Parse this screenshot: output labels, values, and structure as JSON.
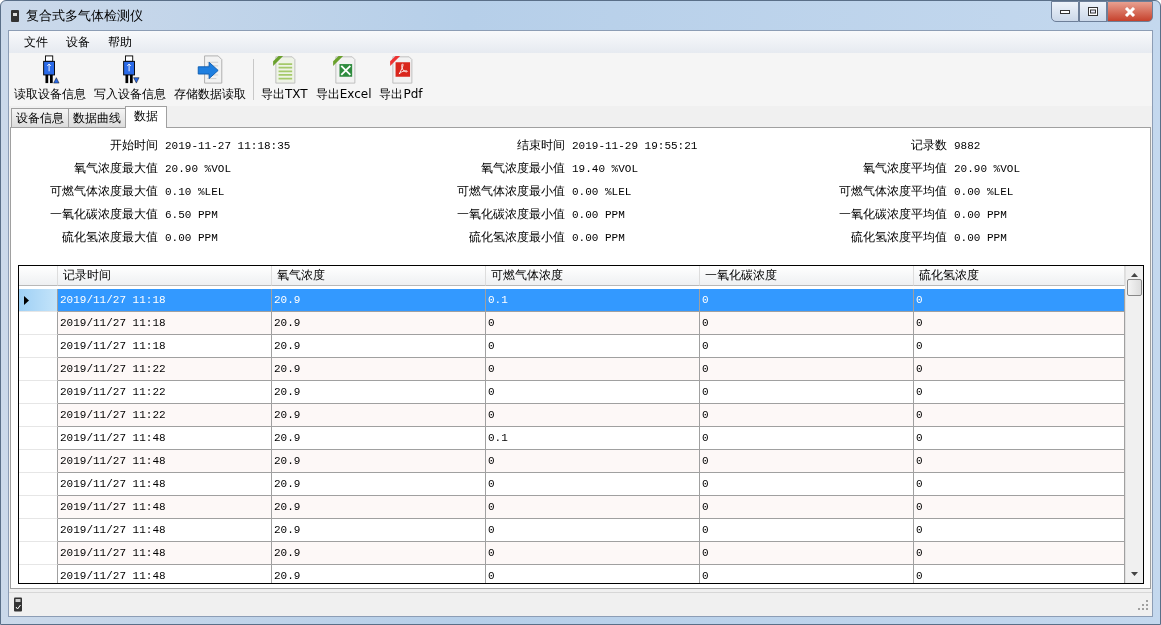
{
  "window": {
    "title": "复合式多气体检测仪"
  },
  "menu": [
    {
      "label": "文件"
    },
    {
      "label": "设备"
    },
    {
      "label": "帮助"
    }
  ],
  "toolbar": {
    "groups": [
      [
        {
          "label": "读取设备信息",
          "kind": "read"
        },
        {
          "label": "写入设备信息",
          "kind": "write"
        },
        {
          "label": "存储数据读取",
          "kind": "load"
        }
      ],
      [
        {
          "label": "导出TXT",
          "kind": "txt"
        },
        {
          "label": "导出Excel",
          "kind": "excel"
        },
        {
          "label": "导出Pdf",
          "kind": "pdf"
        }
      ]
    ]
  },
  "tabs": [
    {
      "label": "设备信息",
      "selected": false
    },
    {
      "label": "数据曲线",
      "selected": false
    },
    {
      "label": "数据",
      "selected": true
    }
  ],
  "summary": [
    {
      "label": "开始时间",
      "value": "2019-11-27 11:18:35"
    },
    {
      "label": "结束时间",
      "value": "2019-11-29 19:55:21"
    },
    {
      "label": "记录数",
      "value": "9882"
    },
    {
      "label": "氧气浓度最大值",
      "value": "20.90 %VOL"
    },
    {
      "label": "氧气浓度最小值",
      "value": "19.40 %VOL"
    },
    {
      "label": "氧气浓度平均值",
      "value": "20.90 %VOL"
    },
    {
      "label": "可燃气体浓度最大值",
      "value": "0.10 %LEL"
    },
    {
      "label": "可燃气体浓度最小值",
      "value": "0.00 %LEL"
    },
    {
      "label": "可燃气体浓度平均值",
      "value": "0.00 %LEL"
    },
    {
      "label": "一氧化碳浓度最大值",
      "value": "6.50 PPM"
    },
    {
      "label": "一氧化碳浓度最小值",
      "value": "0.00 PPM"
    },
    {
      "label": "一氧化碳浓度平均值",
      "value": "0.00 PPM"
    },
    {
      "label": "硫化氢浓度最大值",
      "value": "0.00 PPM"
    },
    {
      "label": "硫化氢浓度最小值",
      "value": "0.00 PPM"
    },
    {
      "label": "硫化氢浓度平均值",
      "value": "0.00 PPM"
    }
  ],
  "table": {
    "columns": [
      "记录时间",
      "氧气浓度",
      "可燃气体浓度",
      "一氧化碳浓度",
      "硫化氢浓度"
    ],
    "rows": [
      {
        "selected": true,
        "cells": [
          "2019/11/27 11:18",
          "20.9",
          "0.1",
          "0",
          "0"
        ]
      },
      {
        "selected": false,
        "cells": [
          "2019/11/27 11:18",
          "20.9",
          "0",
          "0",
          "0"
        ]
      },
      {
        "selected": false,
        "cells": [
          "2019/11/27 11:18",
          "20.9",
          "0",
          "0",
          "0"
        ]
      },
      {
        "selected": false,
        "cells": [
          "2019/11/27 11:22",
          "20.9",
          "0",
          "0",
          "0"
        ]
      },
      {
        "selected": false,
        "cells": [
          "2019/11/27 11:22",
          "20.9",
          "0",
          "0",
          "0"
        ]
      },
      {
        "selected": false,
        "cells": [
          "2019/11/27 11:22",
          "20.9",
          "0",
          "0",
          "0"
        ]
      },
      {
        "selected": false,
        "cells": [
          "2019/11/27 11:48",
          "20.9",
          "0.1",
          "0",
          "0"
        ]
      },
      {
        "selected": false,
        "cells": [
          "2019/11/27 11:48",
          "20.9",
          "0",
          "0",
          "0"
        ]
      },
      {
        "selected": false,
        "cells": [
          "2019/11/27 11:48",
          "20.9",
          "0",
          "0",
          "0"
        ]
      },
      {
        "selected": false,
        "cells": [
          "2019/11/27 11:48",
          "20.9",
          "0",
          "0",
          "0"
        ]
      },
      {
        "selected": false,
        "cells": [
          "2019/11/27 11:48",
          "20.9",
          "0",
          "0",
          "0"
        ]
      },
      {
        "selected": false,
        "cells": [
          "2019/11/27 11:48",
          "20.9",
          "0",
          "0",
          "0"
        ]
      },
      {
        "selected": false,
        "cells": [
          "2019/11/27 11:48",
          "20.9",
          "0",
          "0",
          "0"
        ]
      }
    ]
  }
}
